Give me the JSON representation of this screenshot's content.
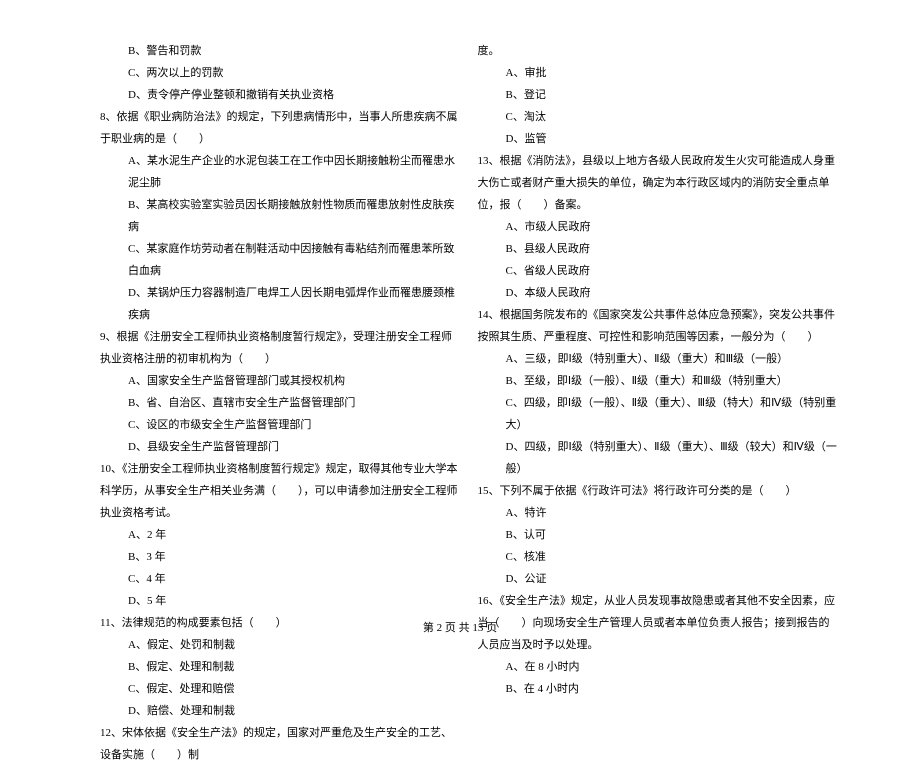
{
  "left_column": {
    "q7_options": [
      "B、警告和罚款",
      "C、两次以上的罚款",
      "D、责令停产停业整顿和撤销有关执业资格"
    ],
    "q8": "8、依据《职业病防治法》的规定，下列患病情形中，当事人所患疾病不属于职业病的是（　　）",
    "q8_options": [
      "A、某水泥生产企业的水泥包装工在工作中因长期接触粉尘而罹患水泥尘肺",
      "B、某高校实验室实验员因长期接触放射性物质而罹患放射性皮肤疾病",
      "C、某家庭作坊劳动者在制鞋活动中因接触有毒粘结剂而罹患苯所致白血病",
      "D、某锅炉压力容器制造厂电焊工人因长期电弧焊作业而罹患腰颈椎疾病"
    ],
    "q9": "9、根据《注册安全工程师执业资格制度暂行规定》，受理注册安全工程师执业资格注册的初审机构为（　　）",
    "q9_options": [
      "A、国家安全生产监督管理部门或其授权机构",
      "B、省、自治区、直辖市安全生产监督管理部门",
      "C、设区的市级安全生产监督管理部门",
      "D、县级安全生产监督管理部门"
    ],
    "q10": "10、《注册安全工程师执业资格制度暂行规定》规定，取得其他专业大学本科学历，从事安全生产相关业务满（　　），可以申请参加注册安全工程师执业资格考试。",
    "q10_options": [
      "A、2 年",
      "B、3 年",
      "C、4 年",
      "D、5 年"
    ],
    "q11": "11、法律规范的构成要素包括（　　）",
    "q11_options": [
      "A、假定、处罚和制裁",
      "B、假定、处理和制裁",
      "C、假定、处理和赔偿",
      "D、赔偿、处理和制裁"
    ],
    "q12": "12、宋体依据《安全生产法》的规定，国家对严重危及生产安全的工艺、设备实施（　　）制"
  },
  "right_column": {
    "q12_continue": "度。",
    "q12_options": [
      "A、审批",
      "B、登记",
      "C、淘汰",
      "D、监管"
    ],
    "q13": "13、根据《消防法》，县级以上地方各级人民政府发生火灾可能造成人身重大伤亡或者财产重大损失的单位，确定为本行政区域内的消防安全重点单位，报（　　）备案。",
    "q13_options": [
      "A、市级人民政府",
      "B、县级人民政府",
      "C、省级人民政府",
      "D、本级人民政府"
    ],
    "q14": "14、根据国务院发布的《国家突发公共事件总体应急预案》，突发公共事件按照其生质、严重程度、可控性和影响范围等因素，一般分为（　　）",
    "q14_options": [
      "A、三级，即Ⅰ级（特别重大）、Ⅱ级（重大）和Ⅲ级（一般）",
      "B、至级，即Ⅰ级（一般）、Ⅱ级（重大）和Ⅲ级（特别重大）",
      "C、四级，即Ⅰ级（一般）、Ⅱ级（重大）、Ⅲ级（特大）和Ⅳ级（特别重大）",
      "D、四级，即Ⅰ级（特别重大）、Ⅱ级（重大）、Ⅲ级（较大）和Ⅳ级（一般）"
    ],
    "q15": "15、下列不属于依据《行政许可法》将行政许可分类的是（　　）",
    "q15_options": [
      "A、特许",
      "B、认可",
      "C、核准",
      "D、公证"
    ],
    "q16": "16、《安全生产法》规定，从业人员发现事故隐患或者其他不安全因素，应当（　　）向现场安全生产管理人员或者本单位负责人报告；接到报告的人员应当及时予以处理。",
    "q16_options": [
      "A、在 8 小时内",
      "B、在 4 小时内"
    ]
  },
  "footer": "第 2 页 共 13 页"
}
